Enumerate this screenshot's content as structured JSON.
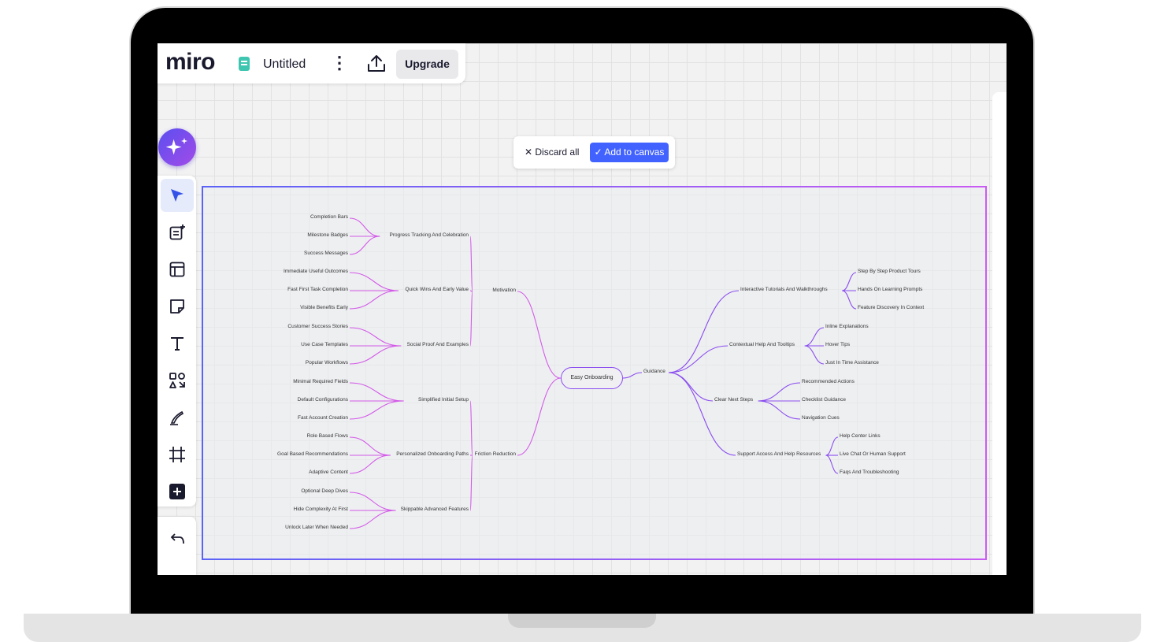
{
  "app": {
    "logo": "miro",
    "board_title": "Untitled",
    "upgrade_label": "Upgrade"
  },
  "action_bar": {
    "discard_label": "✕ Discard all",
    "add_label": "✓ Add to canvas"
  },
  "toolbar": {
    "tools": [
      "select-tool",
      "templates-tool",
      "layout-tool",
      "sticky-note-tool",
      "text-tool",
      "shapes-tool",
      "pen-tool",
      "frame-tool",
      "add-tool"
    ]
  },
  "mindmap": {
    "root": "Easy Onboarding",
    "left": [
      {
        "label": "Motivation",
        "children": [
          {
            "label": "Progress Tracking And Celebration",
            "children": [
              "Completion Bars",
              "Milestone Badges",
              "Success Messages"
            ]
          },
          {
            "label": "Quick Wins And Early Value",
            "children": [
              "Immediate Useful Outcomes",
              "Fast First Task Completion",
              "Visible Benefits Early"
            ]
          },
          {
            "label": "Social Proof And Examples",
            "children": [
              "Customer Success Stories",
              "Use Case Templates",
              "Popular Workflows"
            ]
          }
        ]
      },
      {
        "label": "Friction Reduction",
        "children": [
          {
            "label": "Simplified Initial Setup",
            "children": [
              "Minimal Required Fields",
              "Default Configurations",
              "Fast Account Creation"
            ]
          },
          {
            "label": "Personalized Onboarding Paths",
            "children": [
              "Role Based Flows",
              "Goal Based Recommendations",
              "Adaptive Content"
            ]
          },
          {
            "label": "Skippable Advanced Features",
            "children": [
              "Optional Deep Dives",
              "Hide Complexity At First",
              "Unlock Later When Needed"
            ]
          }
        ]
      }
    ],
    "right": {
      "label": "Guidance",
      "children": [
        {
          "label": "Interactive Tutorials And Walkthroughs",
          "children": [
            "Step By Step Product Tours",
            "Hands On Learning Prompts",
            "Feature Discovery In Context"
          ]
        },
        {
          "label": "Contextual Help And Tooltips",
          "children": [
            "Inline Explanations",
            "Hover Tips",
            "Just In Time Assistance"
          ]
        },
        {
          "label": "Clear Next Steps",
          "children": [
            "Recommended Actions",
            "Checklist Guidance",
            "Navigation Cues"
          ]
        },
        {
          "label": "Support Access And Help Resources",
          "children": [
            "Help Center Links",
            "Live Chat Or Human Support",
            "Faqs And Troubleshooting"
          ]
        }
      ]
    }
  },
  "colors": {
    "accent_blue": "#4262ff",
    "branch_left": "#d35ae8",
    "branch_right": "#8a4cf0",
    "frame_start": "#5b63f6",
    "frame_end": "#c95bf4"
  }
}
